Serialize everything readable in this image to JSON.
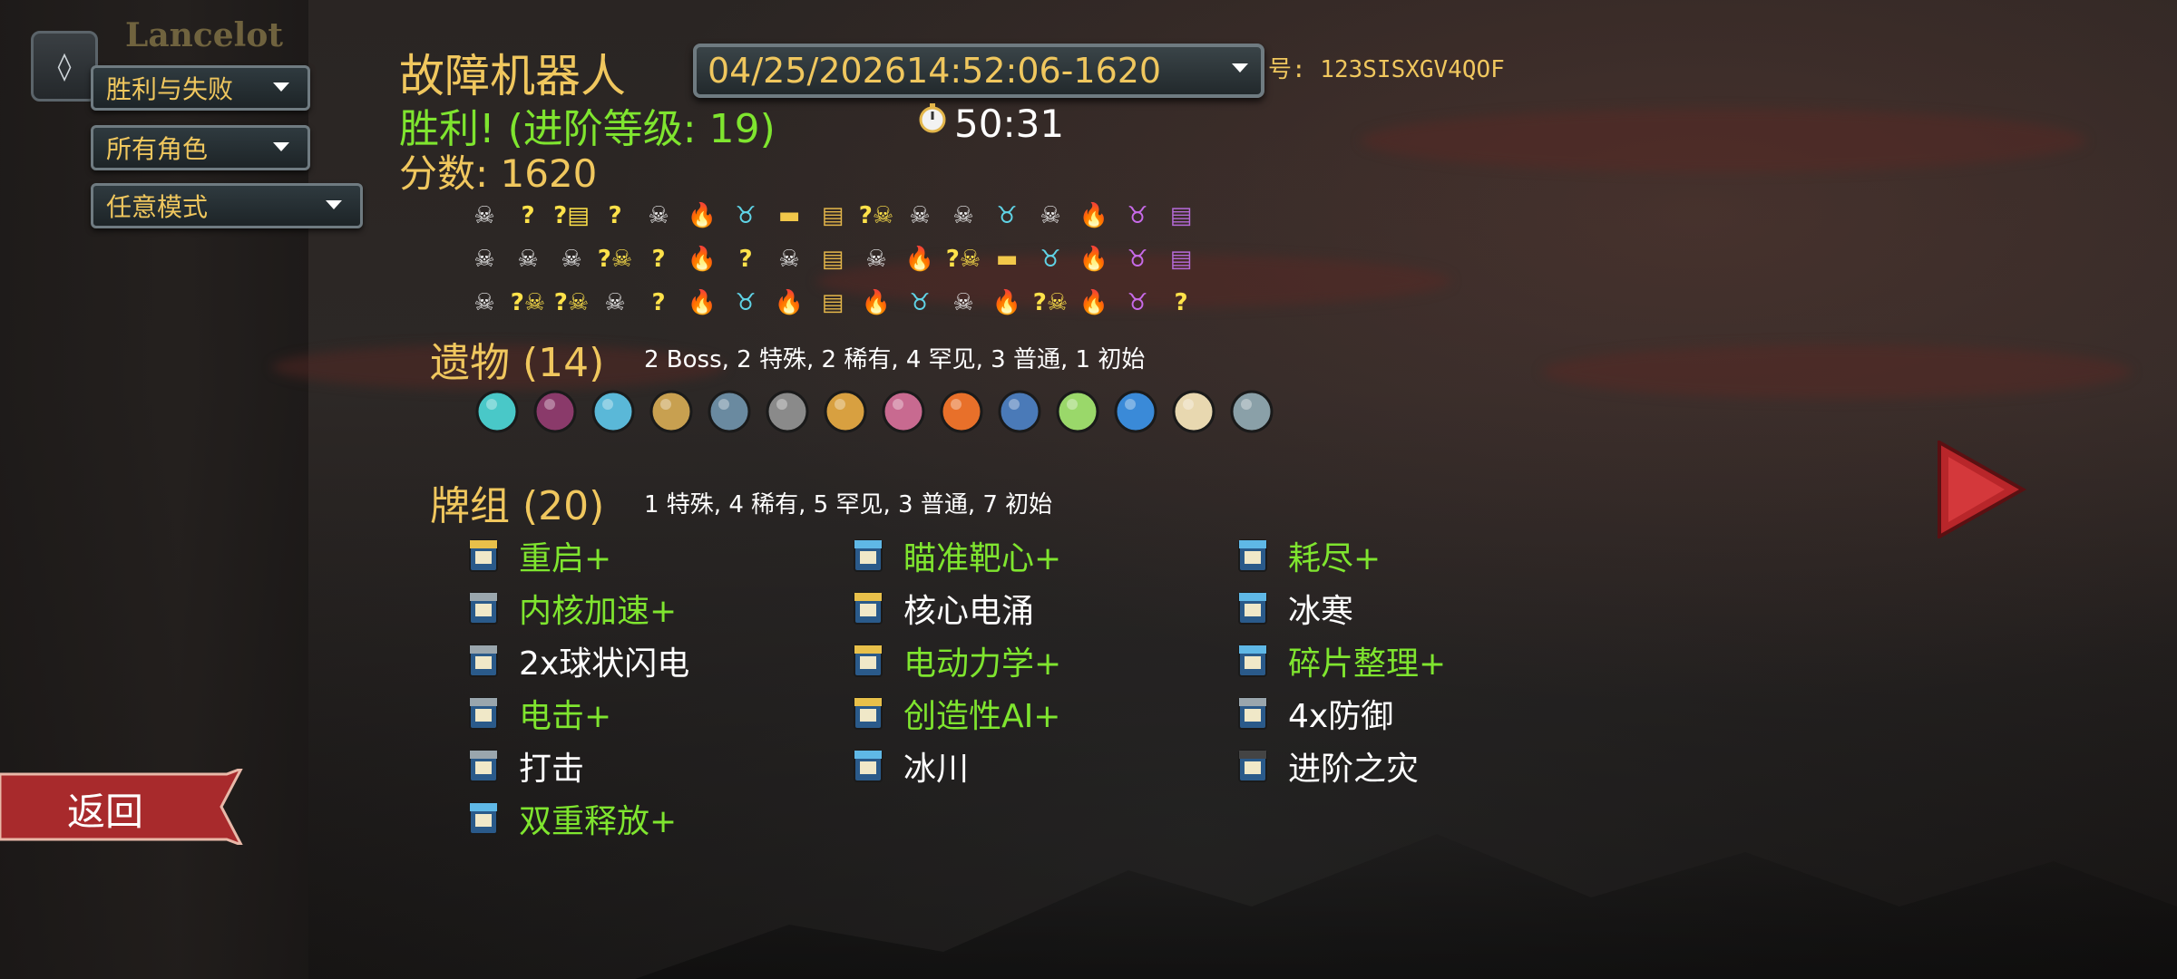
{
  "filters": {
    "profile": "Lancelot",
    "outcome": "胜利与失败",
    "character": "所有角色",
    "mode": "任意模式"
  },
  "run": {
    "character": "故障机器人",
    "date": "04/25/202614:52:06-1620",
    "seed_label": "号: 123SISXGV4QOF",
    "result": "胜利! (进阶等级: 19)",
    "score": "分数: 1620",
    "time": "50:31"
  },
  "path_rows": [
    [
      "monster",
      "unknown",
      "unknown-chest",
      "unknown",
      "monster",
      "fire",
      "elite",
      "shop",
      "chest",
      "unknown-monster",
      "monster",
      "monster",
      "elite",
      "monster",
      "fire",
      "boss",
      "purple-chest"
    ],
    [
      "monster",
      "monster",
      "monster",
      "unknown-monster",
      "unknown",
      "fire",
      "unknown",
      "monster",
      "chest",
      "monster",
      "fire",
      "unknown-monster",
      "shop",
      "elite",
      "fire",
      "boss",
      "purple-chest"
    ],
    [
      "monster",
      "unknown-monster",
      "unknown-monster",
      "monster",
      "unknown",
      "fire",
      "elite",
      "fire",
      "chest",
      "fire",
      "elite",
      "monster",
      "fire",
      "unknown-monster",
      "fire",
      "boss",
      "unknown"
    ]
  ],
  "relics": {
    "title": "遗物 (14)",
    "summary": "2 Boss, 2 特殊, 2 稀有, 4 罕见, 3 普通, 1 初始",
    "items": [
      "orb-icon",
      "dark-crown-icon",
      "tube-icon",
      "beetle-card-icon",
      "whip-coil-icon",
      "kettlebell-icon",
      "robot-arm-icon",
      "pink-book-icon",
      "fire-jar-icon",
      "blue-beast-icon",
      "green-scroll-icon",
      "blue-lantern-icon",
      "ginseng-icon",
      "teapot-icon"
    ]
  },
  "deck": {
    "title": "牌组 (20)",
    "summary": "1 特殊, 4 稀有, 5 罕见, 3 普通, 7 初始",
    "columns": [
      [
        {
          "name": "重启+",
          "upgraded": true,
          "rarity": "rare"
        },
        {
          "name": "内核加速+",
          "upgraded": true,
          "rarity": "common"
        },
        {
          "name": "2x球状闪电",
          "upgraded": false,
          "rarity": "basic"
        },
        {
          "name": "电击+",
          "upgraded": true,
          "rarity": "common"
        },
        {
          "name": "打击",
          "upgraded": false,
          "rarity": "basic"
        },
        {
          "name": "双重释放+",
          "upgraded": true,
          "rarity": "uncommon"
        }
      ],
      [
        {
          "name": "瞄准靶心+",
          "upgraded": true,
          "rarity": "uncommon"
        },
        {
          "name": "核心电涌",
          "upgraded": false,
          "rarity": "rare"
        },
        {
          "name": "电动力学+",
          "upgraded": true,
          "rarity": "rare"
        },
        {
          "name": "创造性AI+",
          "upgraded": true,
          "rarity": "rare"
        },
        {
          "name": "冰川",
          "upgraded": false,
          "rarity": "uncommon"
        }
      ],
      [
        {
          "name": "耗尽+",
          "upgraded": true,
          "rarity": "uncommon"
        },
        {
          "name": "冰寒",
          "upgraded": false,
          "rarity": "uncommon"
        },
        {
          "name": "碎片整理+",
          "upgraded": true,
          "rarity": "uncommon"
        },
        {
          "name": "4x防御",
          "upgraded": false,
          "rarity": "basic"
        },
        {
          "name": "进阶之灾",
          "upgraded": false,
          "rarity": "special"
        }
      ]
    ]
  },
  "buttons": {
    "back": "返回"
  },
  "colors": {
    "gold": "#f0c75e",
    "upgraded_green": "#7fe52f",
    "text_white": "#ffffff",
    "red_button": "#b8262a"
  }
}
